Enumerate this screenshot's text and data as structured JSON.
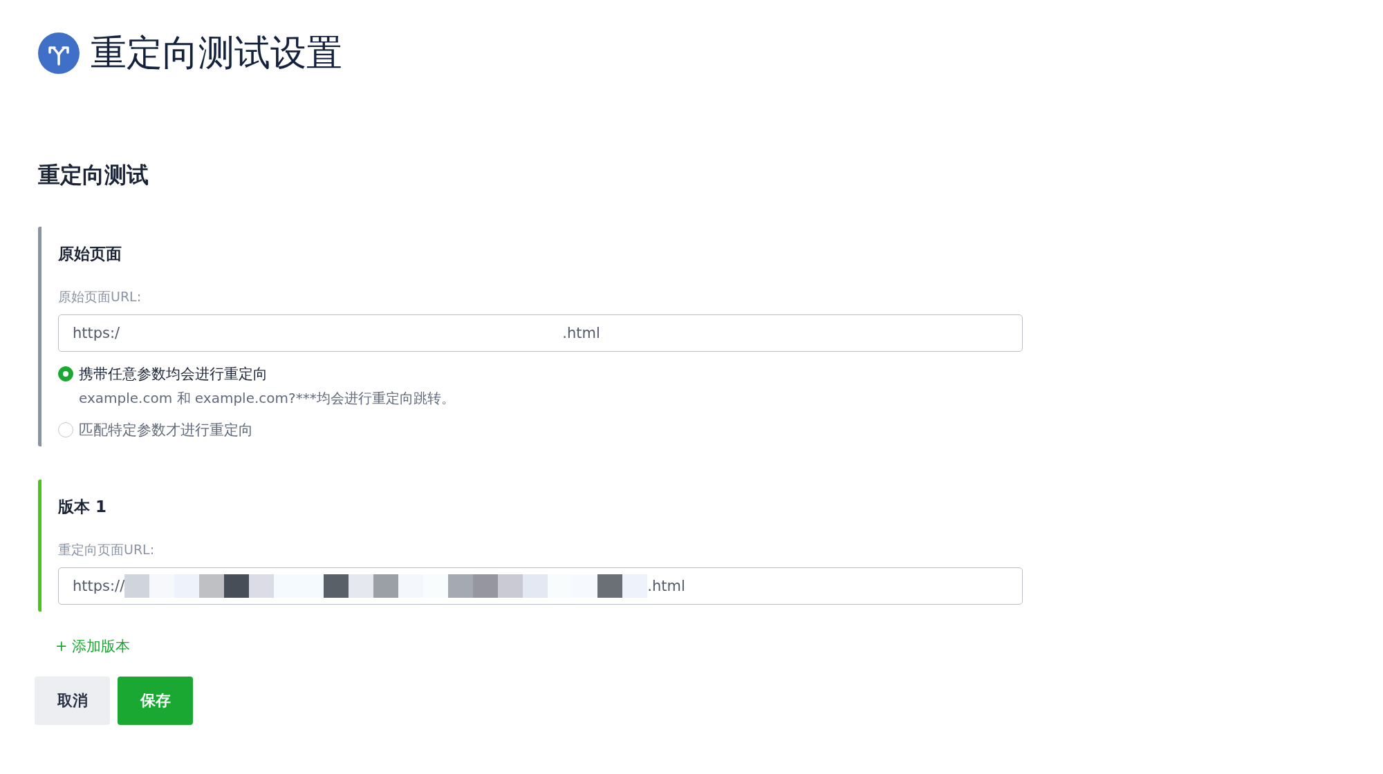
{
  "title": "重定向测试设置",
  "section_title": "重定向测试",
  "panels": [
    {
      "kind": "original",
      "heading": "原始页面",
      "field_label": "原始页面URL:",
      "value_start": "https:/",
      "value_end": ".html",
      "masked": false,
      "options": [
        {
          "label": "携带任意参数均会进行重定向",
          "selected": true,
          "hint": "example.com 和 example.com?***均会进行重定向跳转。"
        },
        {
          "label": "匹配特定参数才进行重定向",
          "selected": false
        }
      ]
    },
    {
      "kind": "variant",
      "heading": "版本 1",
      "field_label": "重定向页面URL:",
      "value_start": "https://",
      "value_end": ".html",
      "masked": true
    }
  ],
  "add_link": "+ 添加版本",
  "buttons": [
    {
      "kind": "secondary",
      "label": "取消"
    },
    {
      "kind": "primary",
      "label": "保存"
    }
  ]
}
